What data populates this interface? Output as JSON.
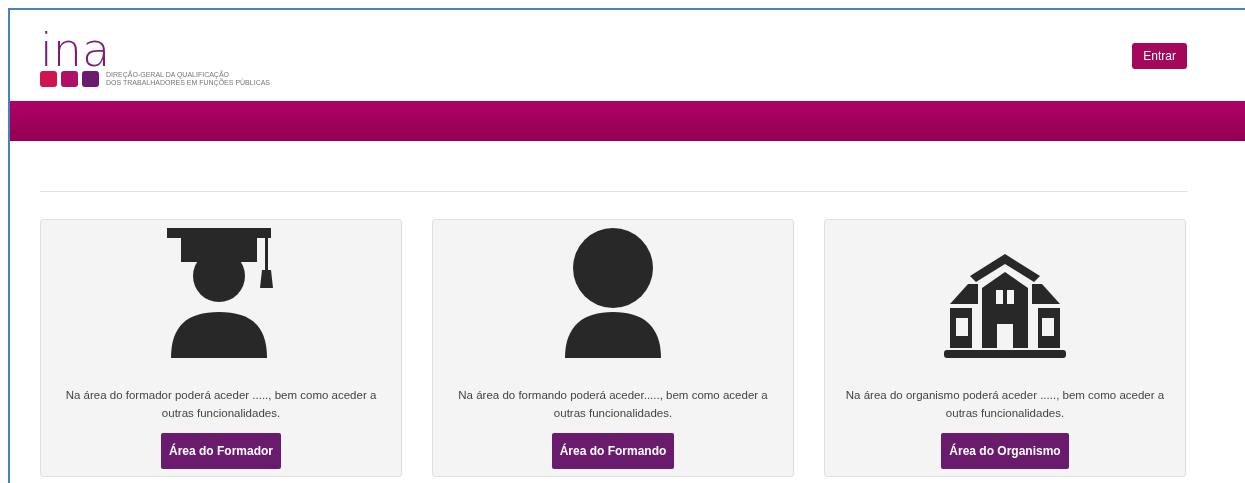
{
  "header": {
    "logo": {
      "wordmark": "ina",
      "subtitle_lines": [
        "DIREÇÃO-GERAL DA QUALIFICAÇÃO",
        "DOS TRABALHADORES EM FUNÇÕES PÚBLICAS"
      ]
    },
    "login_button": "Entrar"
  },
  "cards": [
    {
      "kind": "graduate",
      "description": "Na área do formador poderá aceder ....., bem como aceder a outras funcionalidades.",
      "button": "Área do Formador"
    },
    {
      "kind": "person",
      "description": "Na área do formando poderá aceder....., bem como aceder a outras funcionalidades.",
      "button": "Área do Formando"
    },
    {
      "kind": "building",
      "description": "Na área do organismo poderá aceder ....., bem como aceder a outras funcionalidades.",
      "button": "Área do Organismo"
    }
  ]
}
